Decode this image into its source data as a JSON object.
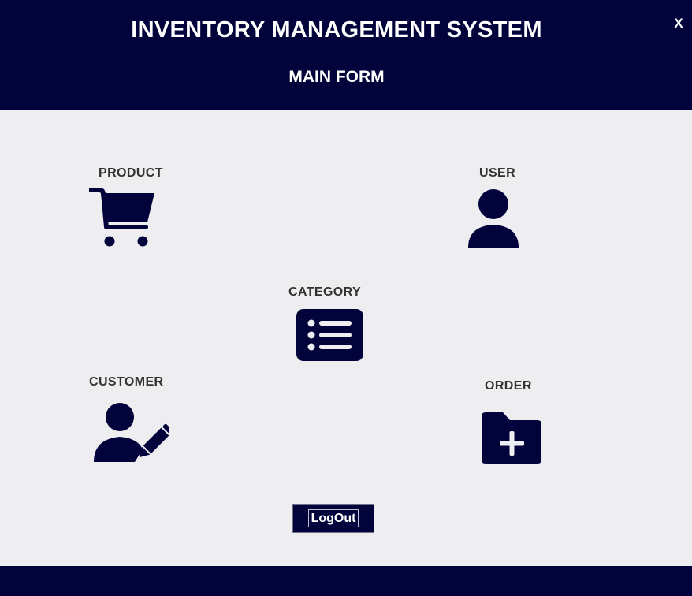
{
  "header": {
    "app_title": "INVENTORY MANAGEMENT SYSTEM",
    "form_title": "MAIN FORM",
    "close_label": "X"
  },
  "menu": {
    "product": {
      "label": "PRODUCT",
      "icon": "shopping-cart-icon"
    },
    "user": {
      "label": "USER",
      "icon": "user-icon"
    },
    "category": {
      "label": "CATEGORY",
      "icon": "list-icon"
    },
    "customer": {
      "label": "CUSTOMER",
      "icon": "user-edit-icon"
    },
    "order": {
      "label": "ORDER",
      "icon": "folder-plus-icon"
    }
  },
  "logout": {
    "label": "LogOut"
  },
  "colors": {
    "primary": "#01033A",
    "background": "#EEEDEF",
    "label_text": "#333333"
  }
}
